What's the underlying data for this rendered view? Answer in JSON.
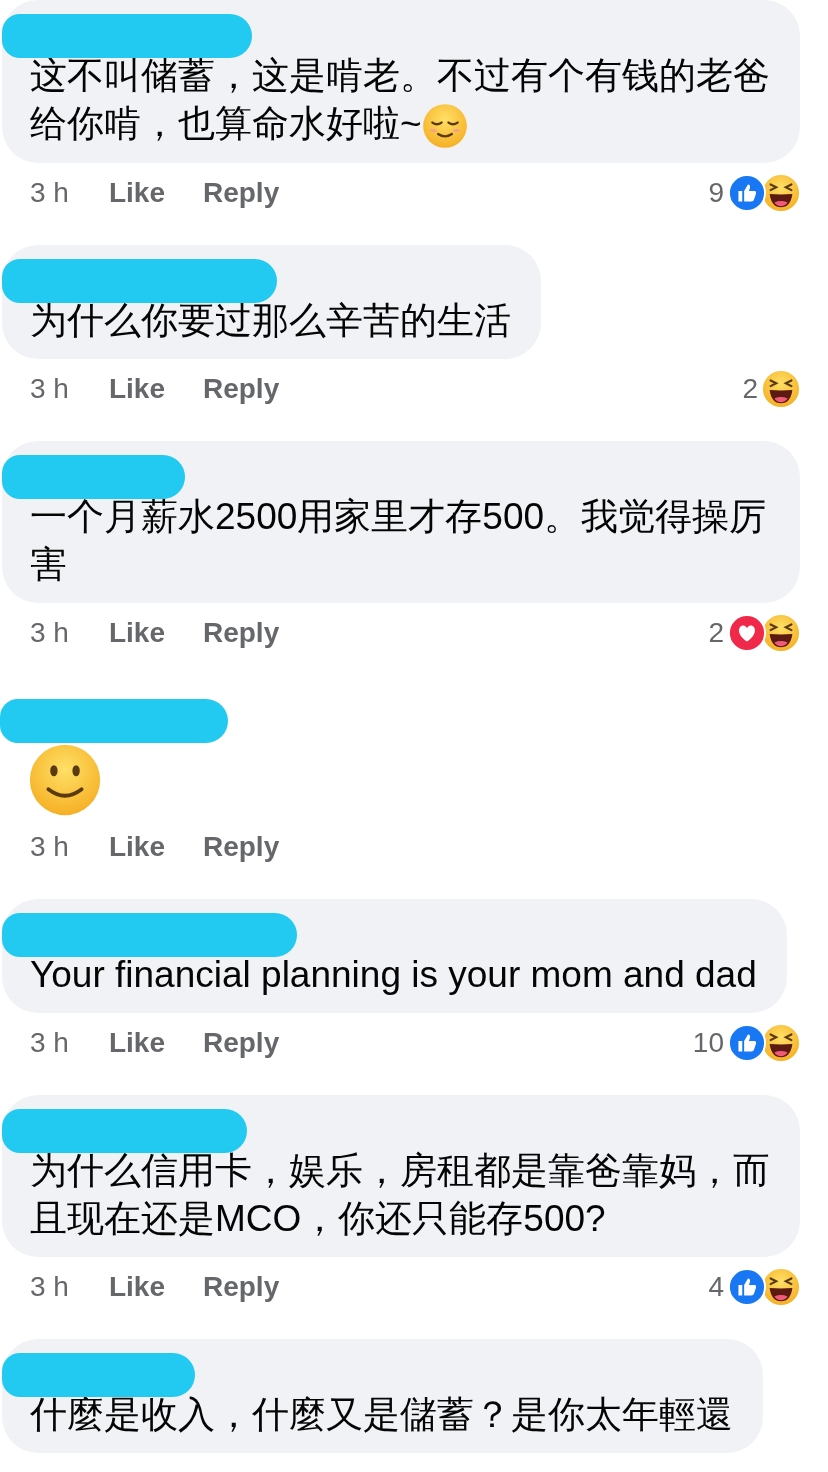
{
  "comments": [
    {
      "kind": "text",
      "text": "这不叫储蓄，这是啃老。不过有个有钱的老爸给你啃，也算命水好啦~",
      "emoji": {
        "kind": "relieved"
      },
      "time": "3 h",
      "like": "Like",
      "reply": "Reply",
      "reaction_count": "9",
      "reactions": [
        {
          "kind": "like"
        },
        {
          "kind": "haha"
        }
      ]
    },
    {
      "kind": "text",
      "text": "为什么你要过那么辛苦的生活",
      "time": "3 h",
      "like": "Like",
      "reply": "Reply",
      "reaction_count": "2",
      "reactions": [
        {
          "kind": "haha"
        }
      ]
    },
    {
      "kind": "text",
      "text": "一个月薪水2500用家里才存500。我觉得操厉害",
      "time": "3 h",
      "like": "Like",
      "reply": "Reply",
      "reaction_count": "2",
      "reactions": [
        {
          "kind": "love"
        },
        {
          "kind": "haha"
        }
      ]
    },
    {
      "kind": "emoji",
      "emoji": {
        "kind": "smile"
      },
      "time": "3 h",
      "like": "Like",
      "reply": "Reply"
    },
    {
      "kind": "text",
      "text": "Your financial planning is your mom and dad",
      "time": "3 h",
      "like": "Like",
      "reply": "Reply",
      "reaction_count": "10",
      "reactions": [
        {
          "kind": "like"
        },
        {
          "kind": "haha"
        }
      ]
    },
    {
      "kind": "text",
      "text": "为什么信用卡，娱乐，房租都是靠爸靠妈，而且现在还是MCO，你还只能存500?",
      "time": "3 h",
      "like": "Like",
      "reply": "Reply",
      "reaction_count": "4",
      "reactions": [
        {
          "kind": "like"
        },
        {
          "kind": "haha"
        }
      ]
    },
    {
      "kind": "text",
      "text": "什麼是收入，什麼又是儲蓄？是你太年輕還"
    }
  ]
}
